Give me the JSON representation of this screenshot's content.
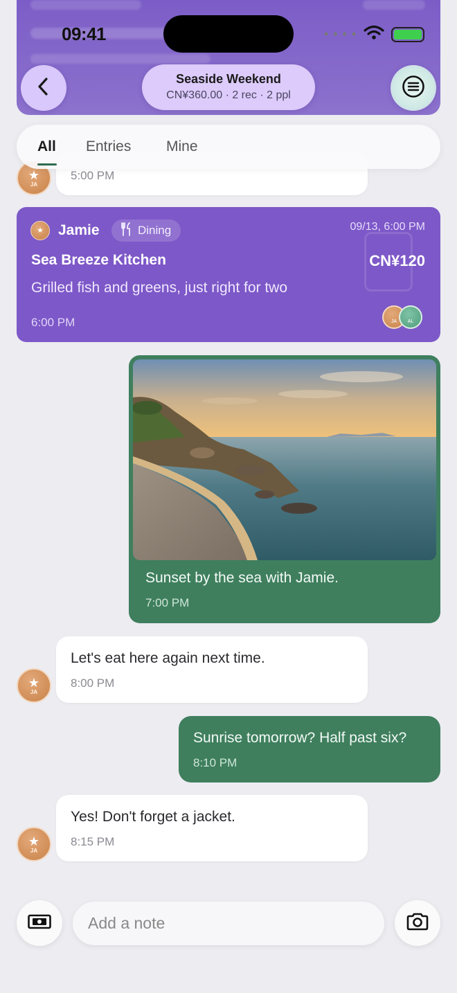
{
  "status_bar": {
    "time": "09:41"
  },
  "header": {
    "title": "Seaside Weekend",
    "subtitle": "CN¥360.00 · 2 rec · 2 ppl"
  },
  "tabs": [
    {
      "label": "All",
      "active": true
    },
    {
      "label": "Entries",
      "active": false
    },
    {
      "label": "Mine",
      "active": false
    }
  ],
  "messages": {
    "partial_in": {
      "time": "5:00 PM",
      "initials": "JA"
    },
    "expense": {
      "author": "Jamie",
      "author_initials": "JA",
      "category": "Dining",
      "date": "09/13, 6:00 PM",
      "title": "Sea Breeze Kitchen",
      "amount": "CN¥120",
      "description": "Grilled fish and greens, just right for two",
      "time": "6:00 PM",
      "participants": [
        "JA",
        "AL"
      ]
    },
    "photo": {
      "caption": "Sunset by the sea with Jamie.",
      "time": "7:00 PM"
    },
    "in_1": {
      "text": "Let's eat here again next time.",
      "time": "8:00 PM",
      "initials": "JA"
    },
    "out_1": {
      "text": "Sunrise tomorrow? Half past six?",
      "time": "8:10 PM"
    },
    "in_2": {
      "text": "Yes! Don't forget a jacket.",
      "time": "8:15 PM",
      "initials": "JA"
    }
  },
  "composer": {
    "placeholder": "Add a note"
  },
  "colors": {
    "accent_purple": "#7d58c8",
    "outgoing_green": "#3f7f5e",
    "background": "#ececf1"
  },
  "icons": {
    "back": "chevron-left-icon",
    "menu": "list-menu-icon",
    "dining": "fork-knife-icon",
    "money": "cash-icon",
    "camera": "camera-icon"
  }
}
